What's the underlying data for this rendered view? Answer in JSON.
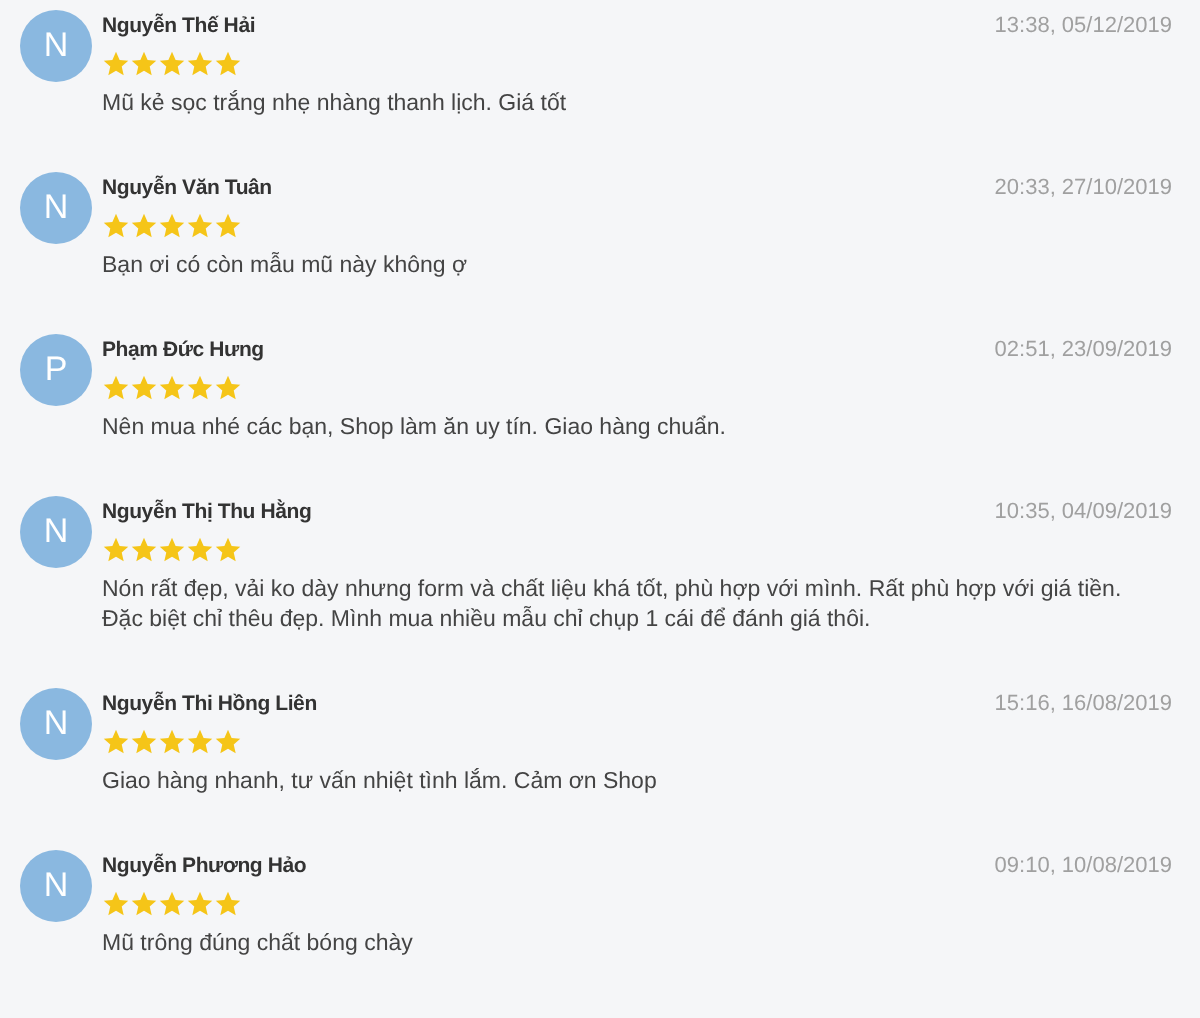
{
  "reviews": [
    {
      "initial": "N",
      "name": "Nguyễn Thế Hải",
      "stars": 5,
      "time": "13:38, 05/12/2019",
      "text": "Mũ kẻ sọc trắng nhẹ nhàng thanh lịch. Giá tốt"
    },
    {
      "initial": "N",
      "name": "Nguyễn Văn Tuân",
      "stars": 5,
      "time": "20:33, 27/10/2019",
      "text": "Bạn ơi có còn mẫu mũ này không ợ"
    },
    {
      "initial": "P",
      "name": "Phạm Đức Hưng",
      "stars": 5,
      "time": "02:51, 23/09/2019",
      "text": "Nên mua nhé các bạn, Shop làm ăn uy tín. Giao hàng chuẩn."
    },
    {
      "initial": "N",
      "name": "Nguyễn Thị Thu Hằng",
      "stars": 5,
      "time": "10:35, 04/09/2019",
      "text": "Nón rất đẹp, vải ko dày nhưng form và chất liệu khá tốt, phù hợp với mình. Rất phù hợp với giá tiền. Đặc biệt chỉ thêu đẹp. Mình mua nhiều mẫu chỉ chụp 1 cái để đánh giá thôi."
    },
    {
      "initial": "N",
      "name": "Nguyễn Thi Hồng Liên",
      "stars": 5,
      "time": "15:16, 16/08/2019",
      "text": "Giao hàng nhanh, tư vấn nhiệt tình lắm. Cảm ơn Shop"
    },
    {
      "initial": "N",
      "name": "Nguyễn Phương Hảo",
      "stars": 5,
      "time": "09:10, 10/08/2019",
      "text": "Mũ trông đúng chất bóng chày"
    }
  ]
}
